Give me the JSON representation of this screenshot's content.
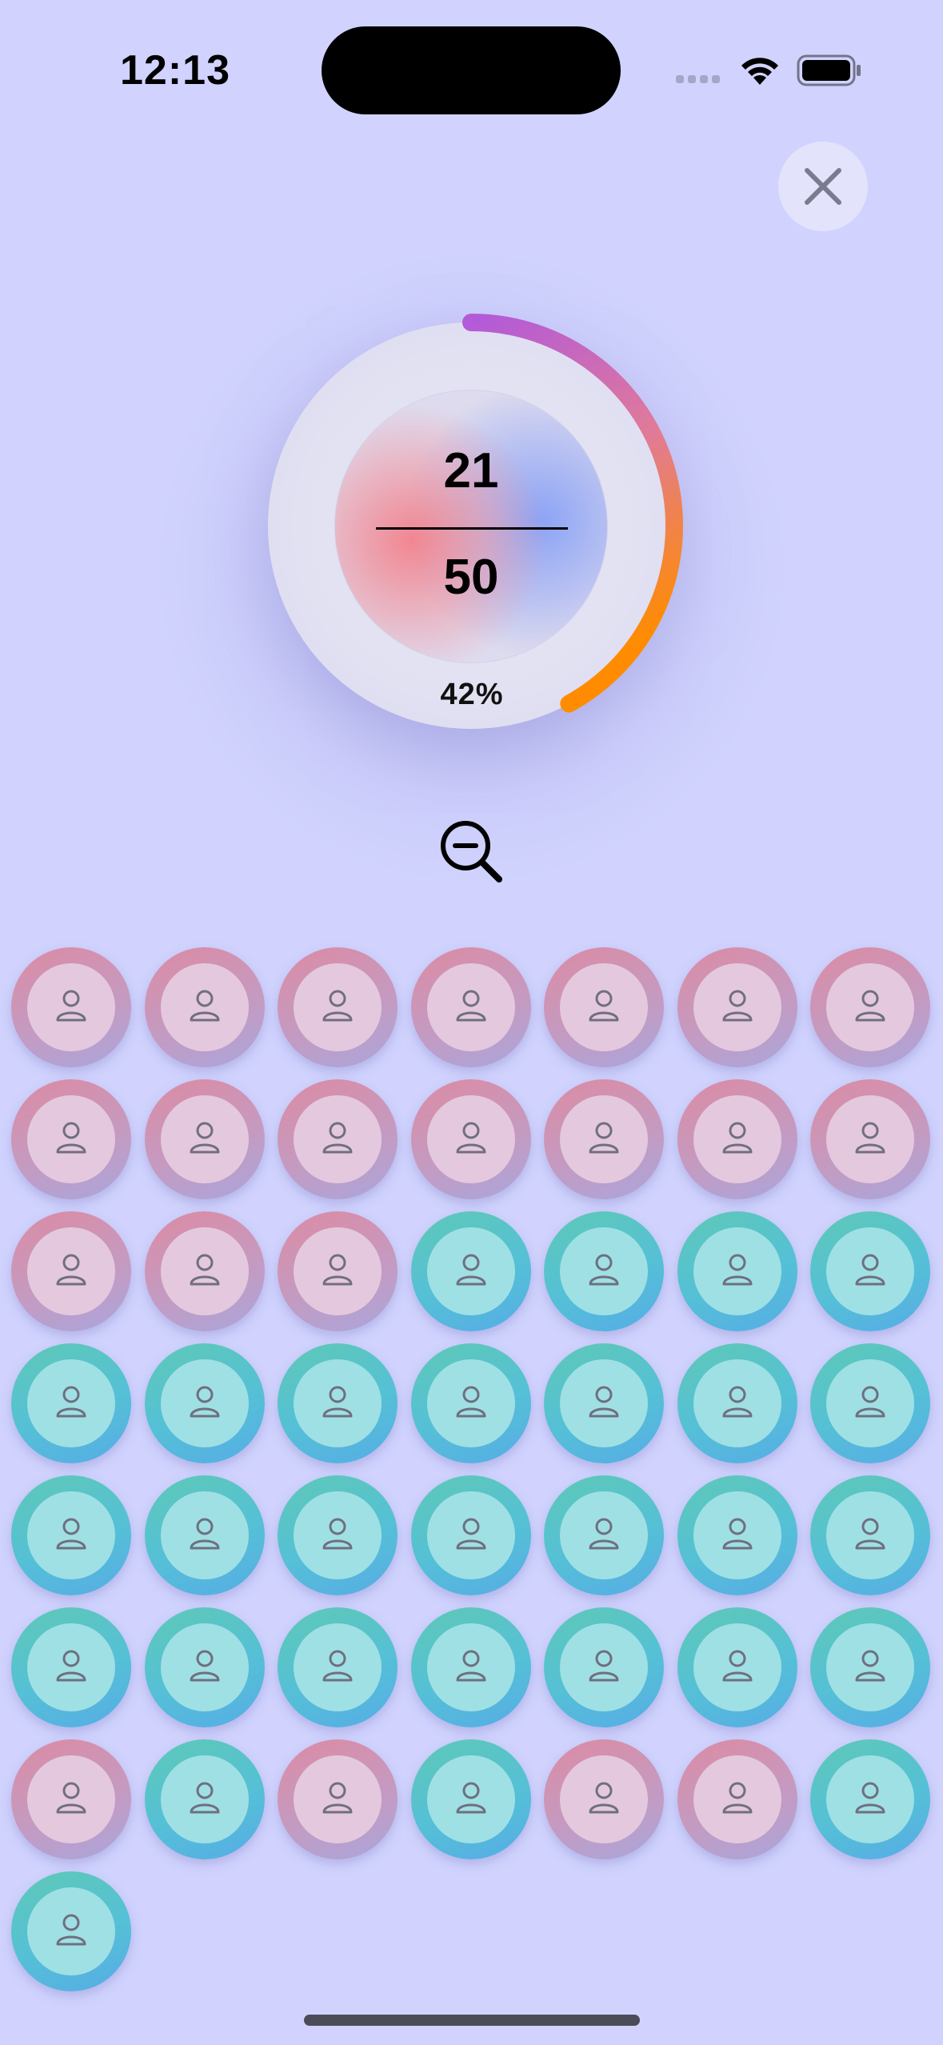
{
  "status_bar": {
    "time": "12:13"
  },
  "progress": {
    "taken": "21",
    "total": "50",
    "percent_label": "42%",
    "fraction": 0.42,
    "arc_colors": [
      "#b35ad8",
      "#e07a9a",
      "#ff8c00"
    ]
  },
  "icons": {
    "close": "close-icon",
    "zoom_out": "zoom-out-icon",
    "seat": "person-icon"
  },
  "colors": {
    "background": "#d1d3fe",
    "seat_occupied": "#dc8ba3",
    "seat_available": "#5ec9b6"
  },
  "seats": [
    "pink",
    "pink",
    "pink",
    "pink",
    "pink",
    "pink",
    "pink",
    "pink",
    "pink",
    "pink",
    "pink",
    "pink",
    "pink",
    "pink",
    "pink",
    "pink",
    "pink",
    "teal",
    "teal",
    "teal",
    "teal",
    "teal",
    "teal",
    "teal",
    "teal",
    "teal",
    "teal",
    "teal",
    "teal",
    "teal",
    "teal",
    "teal",
    "teal",
    "teal",
    "teal",
    "teal",
    "teal",
    "teal",
    "teal",
    "teal",
    "teal",
    "teal",
    "pink",
    "teal",
    "pink",
    "teal",
    "pink",
    "pink",
    "teal",
    "teal"
  ]
}
